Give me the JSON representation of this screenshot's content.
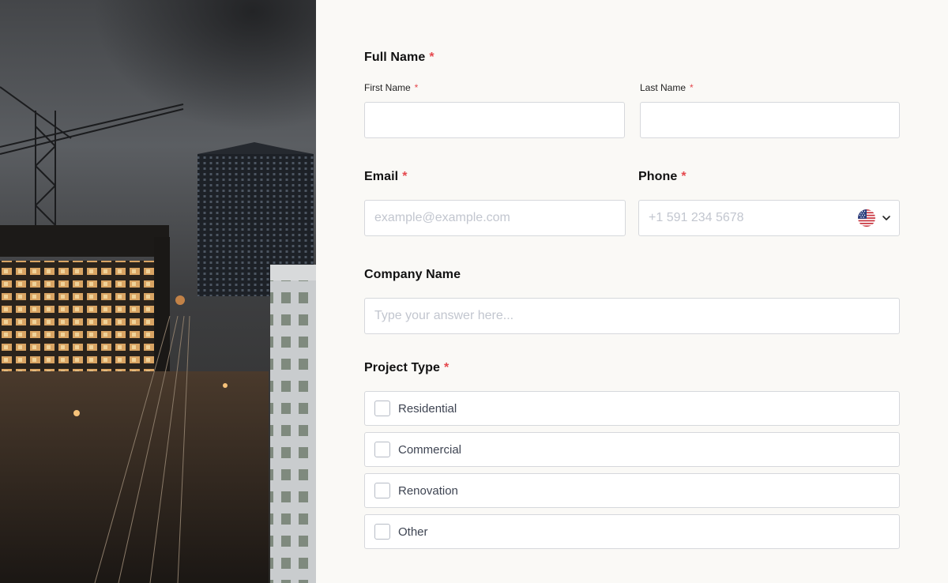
{
  "form": {
    "full_name": {
      "label": "Full Name",
      "required_mark": "*",
      "first": {
        "label": "First Name",
        "required_mark": "*",
        "value": "",
        "placeholder": ""
      },
      "last": {
        "label": "Last Name",
        "required_mark": "*",
        "value": "",
        "placeholder": ""
      }
    },
    "email": {
      "label": "Email",
      "required_mark": "*",
      "value": "",
      "placeholder": "example@example.com"
    },
    "phone": {
      "label": "Phone",
      "required_mark": "*",
      "value": "",
      "placeholder": "+1 591 234 5678",
      "country_icon": "us-flag-icon"
    },
    "company": {
      "label": "Company Name",
      "value": "",
      "placeholder": "Type your answer here..."
    },
    "project_type": {
      "label": "Project Type",
      "required_mark": "*",
      "options": [
        {
          "label": "Residential",
          "checked": false
        },
        {
          "label": "Commercial",
          "checked": false
        },
        {
          "label": "Renovation",
          "checked": false
        },
        {
          "label": "Other",
          "checked": false
        }
      ]
    }
  },
  "colors": {
    "background": "#faf9f6",
    "required": "#e5484d",
    "border": "#d6d8dc",
    "placeholder": "#c2c6cf",
    "label": "#111111"
  }
}
